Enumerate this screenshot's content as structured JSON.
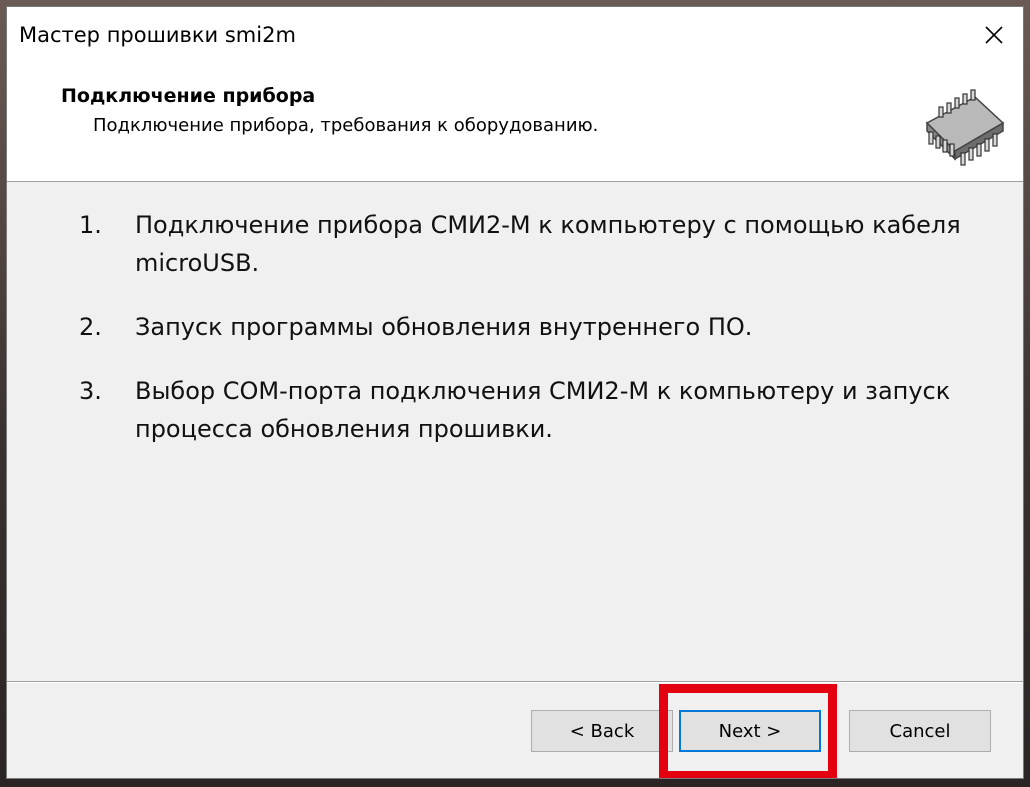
{
  "window": {
    "title": "Мастер прошивки smi2m",
    "close_glyph": "✕"
  },
  "header": {
    "title": "Подключение прибора",
    "subtitle": "Подключение прибора, требования к оборудованию.",
    "icon": "chip-icon"
  },
  "steps": [
    {
      "num": "1.",
      "text": "Подключение прибора СМИ2-М к компьютеру с помощью кабеля microUSB."
    },
    {
      "num": "2.",
      "text": "Запуск программы обновления внутреннего ПО."
    },
    {
      "num": "3.",
      "text": "Выбор COM-порта подключения СМИ2-М к компьютеру и запуск процесса обновления прошивки."
    }
  ],
  "buttons": {
    "back": "< Back",
    "next": "Next >",
    "cancel": "Cancel"
  },
  "colors": {
    "highlight": "#e3000f",
    "focus_border": "#0078d7"
  }
}
